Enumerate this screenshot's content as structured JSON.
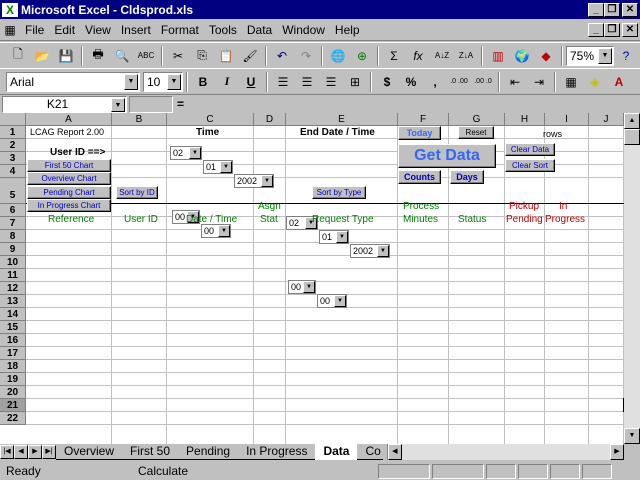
{
  "window": {
    "title": "Microsoft Excel - Cldsprod.xls",
    "app_icon": "X"
  },
  "menu": [
    "File",
    "Edit",
    "View",
    "Insert",
    "Format",
    "Tools",
    "Data",
    "Window",
    "Help"
  ],
  "toolbar": {
    "zoom": "75%",
    "font": "Arial",
    "size": "10",
    "bold": "B",
    "italic": "I",
    "underline": "U",
    "currency": "$",
    "percent": "%",
    "comma": ",",
    "sum": "Σ",
    "fx": "fx"
  },
  "formula": {
    "name_box": "K21",
    "equals": "="
  },
  "columns": [
    {
      "label": "",
      "w": 26
    },
    {
      "label": "A",
      "w": 86
    },
    {
      "label": "B",
      "w": 55
    },
    {
      "label": "C",
      "w": 87
    },
    {
      "label": "D",
      "w": 32
    },
    {
      "label": "E",
      "w": 112
    },
    {
      "label": "F",
      "w": 0
    },
    {
      "label": "G",
      "w": 51
    },
    {
      "label": "H",
      "w": 56
    },
    {
      "label": "I",
      "w": 40
    },
    {
      "label": "J",
      "w": 44
    },
    {
      "label": "K",
      "w": 35
    }
  ],
  "col_labels": [
    "A",
    "B",
    "C",
    "D",
    "E",
    "F",
    "G",
    "H",
    "I",
    "J",
    "K"
  ],
  "row_labels": [
    "1",
    "2",
    "3",
    "4",
    "5",
    "6",
    "7",
    "8",
    "9",
    "10",
    "11",
    "12",
    "13",
    "14",
    "15",
    "16",
    "17",
    "18",
    "19",
    "20",
    "21",
    "22"
  ],
  "cells": {
    "report": "LCAG Report 2.00",
    "time": "Time",
    "end_date": "End Date / Time",
    "user_id": "User ID ==>",
    "rows_label": "rows",
    "h_reference": "Reference",
    "h_user_id": "User ID",
    "h_date_time": "Date / Time",
    "h_asgn": "Asgn",
    "h_stat": "Stat",
    "h_request_type": "Request Type",
    "h_process": "Process",
    "h_minutes": "Minutes",
    "h_status": "Status",
    "h_pickup": "Pickup",
    "h_pending": "Pending",
    "h_in": "In",
    "h_progress": "Progress"
  },
  "buttons": {
    "first50": "First 50 Chart",
    "overview": "Overview Chart",
    "pending": "Pending Chart",
    "inprogress": "In Progress Chart",
    "sort_id": "Sort by ID",
    "sort_type": "Sort by Type",
    "today": "Today",
    "reset": "Reset",
    "get_data": "Get Data",
    "counts": "Counts",
    "days": "Days",
    "clear_data": "Clear Data",
    "clear_sort": "Clear Sort"
  },
  "selects": {
    "start_month": "02",
    "start_day": "01",
    "start_year": "2002",
    "start_hour": "00",
    "start_min": "00",
    "end_month": "02",
    "end_day": "01",
    "end_year": "2002",
    "end_hour": "00",
    "end_min": "00"
  },
  "tabs": [
    "Overview",
    "First 50",
    "Pending",
    "In Progress",
    "Data",
    "Co"
  ],
  "active_tab": "Data",
  "status": {
    "left": "Ready",
    "mode": "Calculate"
  },
  "colors": {
    "title_bg": "#000080",
    "header_green": "#008000",
    "header_red": "#c00000",
    "button_blue": "#0000c0",
    "get_data_blue": "#3366ff"
  }
}
